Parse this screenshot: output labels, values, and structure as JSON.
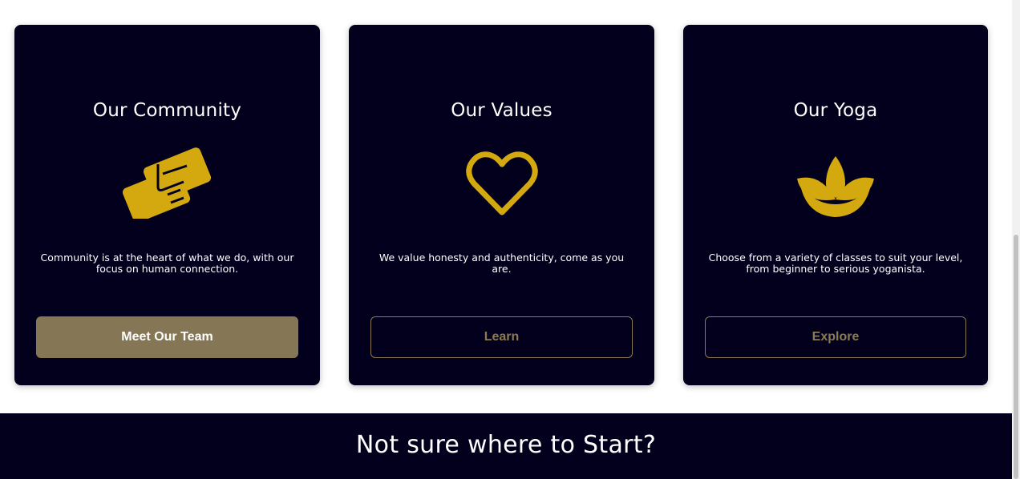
{
  "cards": [
    {
      "title": "Our Community",
      "icon": "handshake-icon",
      "text": "Community is at the heart of what we do, with our focus on human connection.",
      "button": "Meet Our Team"
    },
    {
      "title": "Our Values",
      "icon": "heart-icon",
      "text": "We value honesty and authenticity, come as you are.",
      "button": "Learn"
    },
    {
      "title": "Our Yoga",
      "icon": "lotus-icon",
      "text": "Choose from a variety of classes to suit your level, from beginner to serious yoganista.",
      "button": "Explore"
    }
  ],
  "banner": {
    "title": "Not sure where to Start?"
  },
  "colors": {
    "card_bg": "#02001c",
    "accent_gold": "#d4a910",
    "button_filled": "#857755",
    "button_outline": "#8c7b52"
  }
}
